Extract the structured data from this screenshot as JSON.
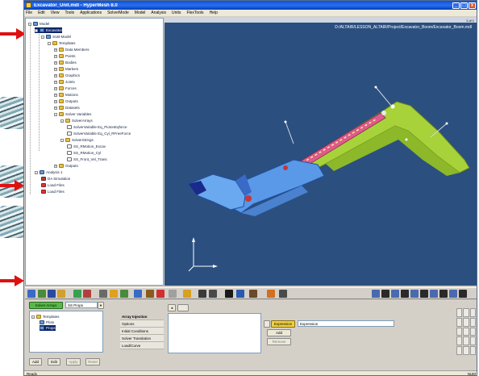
{
  "window": {
    "title": "Excavator_Unit.mdl - HyperMesh 8.0",
    "controls": [
      "_",
      "□",
      "x"
    ]
  },
  "menu": [
    "File",
    "Edit",
    "View",
    "Tools",
    "Applications",
    "SolverMode",
    "Model",
    "Analysis",
    "Units",
    "FlexTools",
    "Help"
  ],
  "viewport": {
    "caption": "D:/ALTAIR/LESSON_ALTAIR/Project/Excavator_Boom/Excavator_Boom.mdl",
    "page_indicator": "1 of 1"
  },
  "tree": [
    {
      "label": "Model",
      "indent": 0,
      "icon": "model-icon",
      "expand": "-"
    },
    {
      "label": "Excavator",
      "indent": 1,
      "icon": "model-icon",
      "expand": "-",
      "selected": true
    },
    {
      "label": "SUB-Model",
      "indent": 2,
      "icon": "model-icon",
      "expand": "-"
    },
    {
      "label": "Templates",
      "indent": 3,
      "icon": "folder-icon",
      "expand": "-"
    },
    {
      "label": "Data Members",
      "indent": 4,
      "icon": "folder-icon",
      "expand": "+"
    },
    {
      "label": "Points",
      "indent": 4,
      "icon": "folder-icon",
      "expand": "+"
    },
    {
      "label": "Bodies",
      "indent": 4,
      "icon": "folder-icon",
      "expand": "+"
    },
    {
      "label": "Markers",
      "indent": 4,
      "icon": "folder-icon",
      "expand": "+"
    },
    {
      "label": "Graphics",
      "indent": 4,
      "icon": "folder-icon",
      "expand": "+"
    },
    {
      "label": "Joints",
      "indent": 4,
      "icon": "folder-icon",
      "expand": "+"
    },
    {
      "label": "Forces",
      "indent": 4,
      "icon": "folder-icon",
      "expand": "+"
    },
    {
      "label": "Motions",
      "indent": 4,
      "icon": "folder-icon",
      "expand": "+"
    },
    {
      "label": "Outputs",
      "indent": 4,
      "icon": "folder-icon",
      "expand": "+"
    },
    {
      "label": "Datasets",
      "indent": 4,
      "icon": "folder-icon",
      "expand": "+"
    },
    {
      "label": "Solver Variables",
      "indent": 4,
      "icon": "folder-icon",
      "expand": "-"
    },
    {
      "label": "SolverArrays",
      "indent": 5,
      "icon": "folder-icon",
      "expand": "-"
    },
    {
      "label": "SolverVariable Eq_PiotonEqforce",
      "indent": 6,
      "icon": "doc-icon"
    },
    {
      "label": "SolverVariable Eq_Cyl_RFreeForce",
      "indent": 6,
      "icon": "doc-icon"
    },
    {
      "label": "SolverStrings",
      "indent": 5,
      "icon": "folder-icon",
      "expand": "-"
    },
    {
      "label": "SS_RMotion_Excav",
      "indent": 6,
      "icon": "doc-icon"
    },
    {
      "label": "SS_RMotion_Cyl",
      "indent": 6,
      "icon": "doc-icon"
    },
    {
      "label": "SS_Front_Vel_Trans",
      "indent": 6,
      "icon": "doc-icon"
    },
    {
      "label": "Outputs",
      "indent": 4,
      "icon": "folder-icon",
      "expand": "+"
    },
    {
      "label": "Analysis 1",
      "indent": 1,
      "icon": "model-icon",
      "expand": "-"
    },
    {
      "label": "DA Simulation",
      "indent": 2,
      "icon": "part-icon"
    },
    {
      "label": "Load Files",
      "indent": 2,
      "icon": "red-icon"
    },
    {
      "label": "Load Files",
      "indent": 2,
      "icon": "red-icon"
    }
  ],
  "bottom": {
    "set_button": "Solver Arrays",
    "combo_value": "SS Props",
    "mini_tree": [
      "Templates",
      "Plots",
      "Props"
    ],
    "list_header": "Array Injection",
    "list_items": [
      "Options",
      "Initial Conditions",
      "Solver Translation",
      "Load/Curve"
    ],
    "action_buttons": [
      "Add",
      "Remove"
    ],
    "yellow_label": "Expression",
    "expression_field": "Expression",
    "bottom_buttons": [
      "Add",
      "Edit",
      "Apply",
      "Reset"
    ]
  },
  "status": {
    "left": "Ready",
    "right": "NUM"
  }
}
